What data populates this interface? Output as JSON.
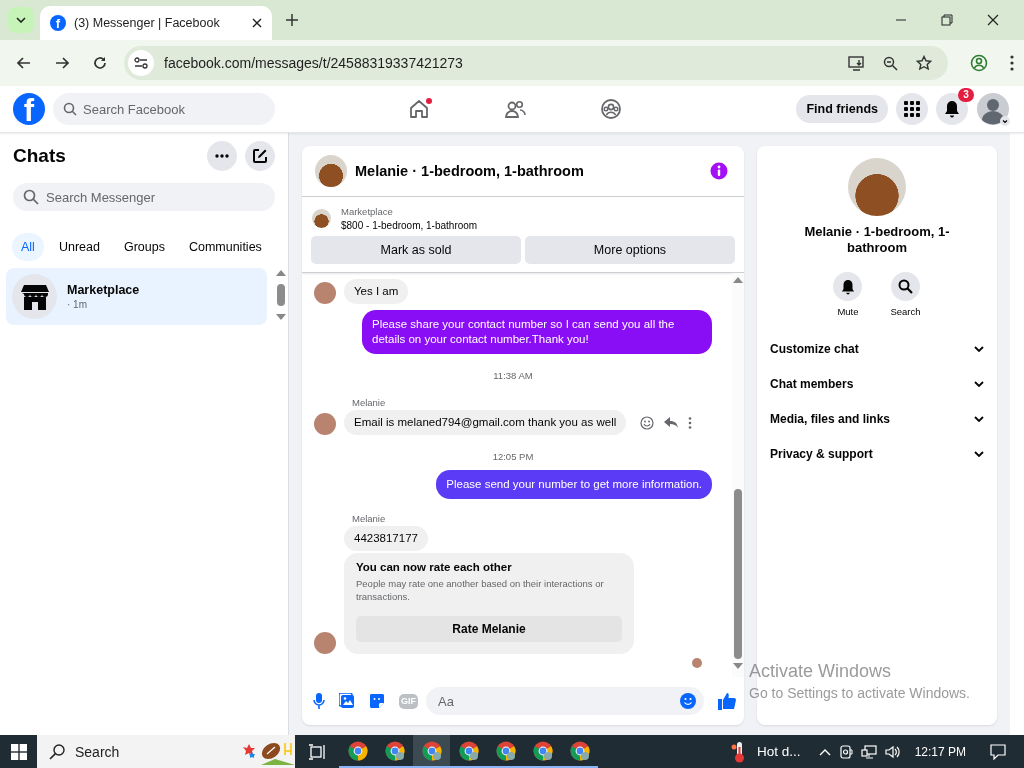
{
  "browser": {
    "tabs": [
      {
        "favicon_letter": "f",
        "title": "(3) Messenger | Facebook",
        "selected": true
      }
    ],
    "url": "facebook.com/messages/t/24588319337421273"
  },
  "fb_header": {
    "logo_letter": "f",
    "search_placeholder": "Search Facebook",
    "nav": [
      {
        "kind": "home",
        "selected": false,
        "dot": true
      },
      {
        "kind": "friends",
        "selected": false,
        "dot": false
      },
      {
        "kind": "groups",
        "selected": false,
        "dot": false
      }
    ],
    "find_friends": "Find friends",
    "notification_count": "3"
  },
  "sidebar": {
    "title": "Chats",
    "search_placeholder": "Search Messenger",
    "filters": [
      {
        "label": "All",
        "selected": true
      },
      {
        "label": "Unread",
        "selected": false
      },
      {
        "label": "Groups",
        "selected": false
      },
      {
        "label": "Communities",
        "selected": false
      }
    ],
    "chats": [
      {
        "name": "Marketplace",
        "time": "· 1m",
        "selected": true
      }
    ]
  },
  "chat": {
    "title": "Melanie · 1-bedroom, 1-bathroom",
    "listing": {
      "label": "Marketplace",
      "title": "$800 - 1-bedroom, 1-bathroom"
    },
    "buttons": [
      "Mark as sold",
      "More options"
    ],
    "messages": [
      {
        "kind": "incoming",
        "text": "Yes I am",
        "avatar": true,
        "actions": false
      },
      {
        "kind": "outgoing",
        "text": "Please share your contact number so I can send you all the details on your contact number.Thank you!",
        "color": "#8a0ef5"
      },
      {
        "kind": "timestamp",
        "text": "11:38 AM"
      },
      {
        "kind": "sender",
        "text": "Melanie"
      },
      {
        "kind": "incoming",
        "text": "Email is melaned794@gmail.com thank you as well",
        "avatar": true,
        "actions": true
      },
      {
        "kind": "timestamp",
        "text": "12:05 PM"
      },
      {
        "kind": "outgoing",
        "text": "Please send your number to get more information.",
        "color": "#5b3bf5"
      },
      {
        "kind": "sender",
        "text": "Melanie"
      },
      {
        "kind": "incoming",
        "text": "4423817177",
        "avatar": false,
        "actions": false
      },
      {
        "kind": "rating_card",
        "title": "You can now rate each other",
        "body": "People may rate one another based on their interactions or transactions.",
        "button": "Rate Melanie",
        "avatar": true
      }
    ],
    "composer": {
      "gif_label": "GIF",
      "placeholder": "Aa"
    }
  },
  "details": {
    "name": "Melanie · 1-bedroom, 1-bathroom",
    "actions": [
      {
        "kind": "mute",
        "label": "Mute"
      },
      {
        "kind": "search",
        "label": "Search"
      }
    ],
    "sections": [
      {
        "label": "Customize chat",
        "expanded": false
      },
      {
        "label": "Chat members",
        "expanded": false
      },
      {
        "label": "Media, files and links",
        "expanded": false
      },
      {
        "label": "Privacy & support",
        "expanded": false
      }
    ]
  },
  "activation_notice": {
    "title": "Activate Windows",
    "subtitle": "Go to Settings to activate Windows."
  },
  "taskbar": {
    "search_label": "Search",
    "apps": [
      {
        "selected": false
      },
      {
        "selected": false
      },
      {
        "selected": true
      },
      {
        "selected": false
      },
      {
        "selected": false
      },
      {
        "selected": false
      },
      {
        "selected": false
      }
    ],
    "weather": "Hot d...",
    "time": "12:17 PM"
  }
}
